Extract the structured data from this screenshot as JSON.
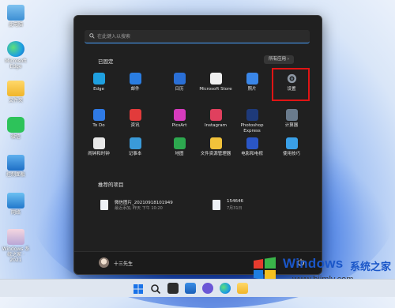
{
  "desktop": {
    "icons": [
      {
        "label": "此电脑",
        "icon": "computer-icon"
      },
      {
        "label": "Microsoft Edge",
        "icon": "edge-icon"
      },
      {
        "label": "文件夹",
        "icon": "folder-icon"
      },
      {
        "label": "微信",
        "icon": "wechat-icon"
      },
      {
        "label": "控制面板",
        "icon": "monitor-icon"
      },
      {
        "label": "网络",
        "icon": "network-icon"
      },
      {
        "label": "Windows 系统之家 · 2021",
        "icon": "image-file-icon"
      }
    ]
  },
  "start_menu": {
    "search_placeholder": "在此键入以搜索",
    "pinned_title": "已固定",
    "all_apps_label": "所有应用 ›",
    "pinned": [
      {
        "label": "Edge",
        "icon": "edge-icon",
        "color": "#1fa0e0"
      },
      {
        "label": "邮件",
        "icon": "mail-icon",
        "color": "#2a7de1"
      },
      {
        "label": "日历",
        "icon": "calendar-icon",
        "color": "#2a6fd6"
      },
      {
        "label": "Microsoft Store",
        "icon": "store-icon",
        "color": "#f0f0f0"
      },
      {
        "label": "照片",
        "icon": "photos-icon",
        "color": "#3a86e8"
      },
      {
        "label": "设置",
        "icon": "settings-gear-icon",
        "color": "#9aa4b0"
      },
      {
        "label": "To Do",
        "icon": "todo-icon",
        "color": "#2f7ae5"
      },
      {
        "label": "资讯",
        "icon": "news-icon",
        "color": "#e23b3b"
      },
      {
        "label": "PicsArt",
        "icon": "picsart-icon",
        "color": "#d63bbd"
      },
      {
        "label": "Instagram",
        "icon": "instagram-icon",
        "color": "#e0405e"
      },
      {
        "label": "Photoshop Express",
        "icon": "photoshop-icon",
        "color": "#1e3a7a"
      },
      {
        "label": "计算器",
        "icon": "calculator-icon",
        "color": "#6a7b8c"
      },
      {
        "label": "闹钟和时钟",
        "icon": "clock-icon",
        "color": "#e8e8e8"
      },
      {
        "label": "记事本",
        "icon": "notepad-icon",
        "color": "#3a9ad9"
      },
      {
        "label": "地图",
        "icon": "maps-icon",
        "color": "#2da84f"
      },
      {
        "label": "文件资源管理器",
        "icon": "file-explorer-icon",
        "color": "#f2c23a"
      },
      {
        "label": "电影和电视",
        "icon": "movies-icon",
        "color": "#2a56c6"
      },
      {
        "label": "使用技巧",
        "icon": "tips-icon",
        "color": "#3aa0e8"
      }
    ],
    "recommended_title": "推荐的项目",
    "recommended": [
      {
        "name": "微信图片_20210918101949",
        "meta": "最近添加, 昨天 下午 10:20"
      },
      {
        "name": "154646",
        "meta": "7月31日"
      }
    ],
    "user_name": "十三先生"
  },
  "watermark": {
    "brand": "Windows",
    "cn": "系统之家",
    "url": "www.bjjmlv.com"
  },
  "taskbar": {
    "items": [
      "start-button",
      "search-button",
      "task-view-button",
      "widgets-button",
      "chat-button",
      "edge-button",
      "file-explorer-button"
    ]
  }
}
